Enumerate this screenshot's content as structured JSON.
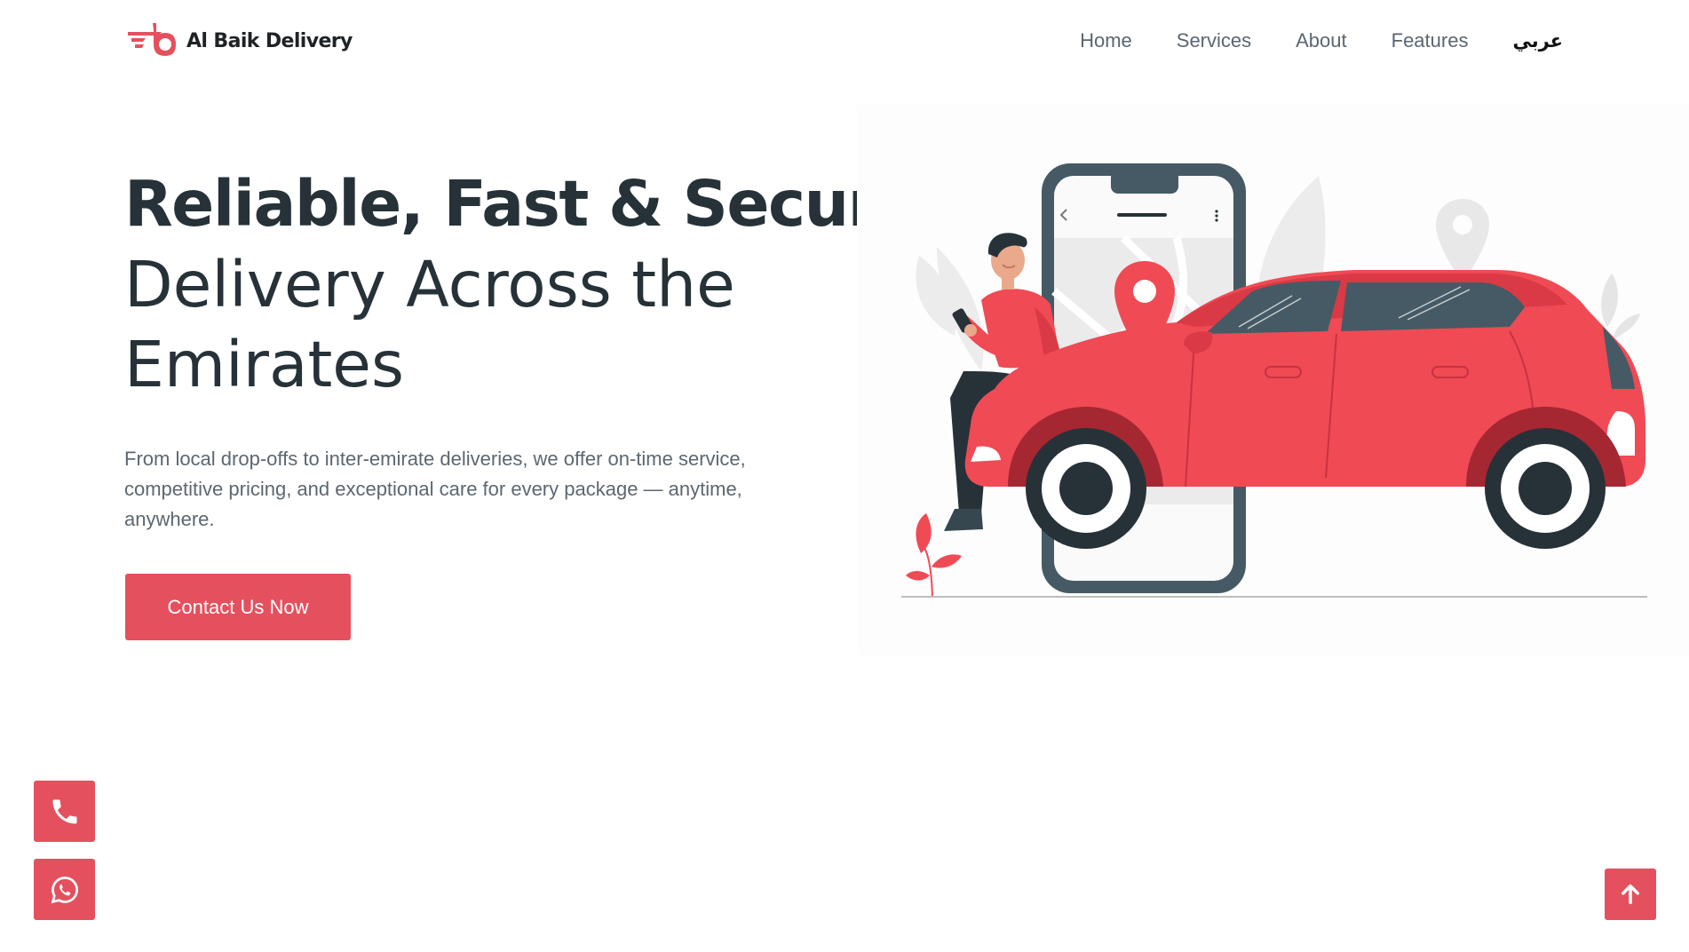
{
  "header": {
    "brand": "Al Baik Delivery",
    "nav": [
      {
        "label": "Home"
      },
      {
        "label": "Services"
      },
      {
        "label": "About"
      },
      {
        "label": "Features"
      },
      {
        "label": "عربي"
      }
    ]
  },
  "hero": {
    "title_bold": "Reliable, Fast & Secure",
    "title_line2": "Delivery Across the",
    "title_line3": "Emirates",
    "description": "From local drop-offs to inter-emirate deliveries, we offer on-time service, competitive pricing, and exceptional care for every package — anytime, anywhere.",
    "cta_label": "Contact Us Now"
  },
  "floating": {
    "phone_icon": "phone-icon",
    "whatsapp_icon": "whatsapp-icon",
    "top_icon": "arrow-up-icon"
  },
  "colors": {
    "accent": "#e5505e",
    "text_dark": "#263238",
    "text_muted": "#5c6770",
    "car_red": "#f04a55"
  }
}
